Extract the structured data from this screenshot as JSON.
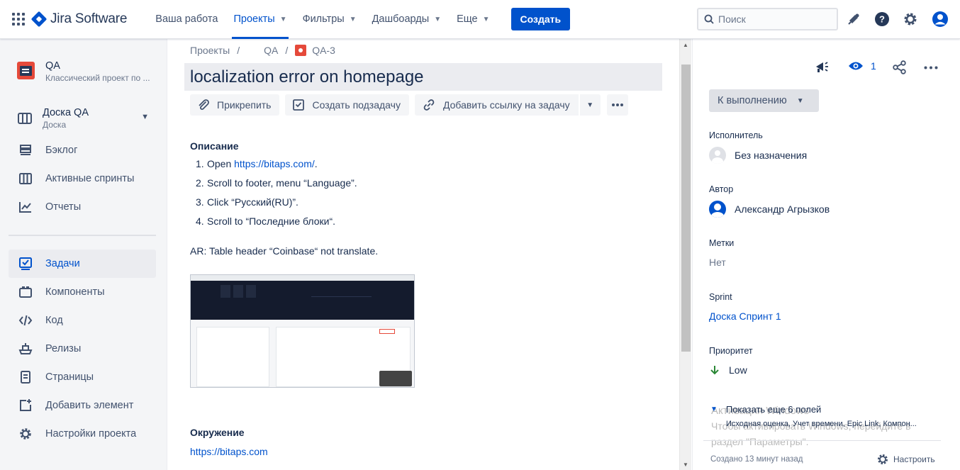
{
  "topnav": {
    "product": "Jira Software",
    "items": [
      {
        "label": "Ваша работа",
        "dropdown": false,
        "active": false
      },
      {
        "label": "Проекты",
        "dropdown": true,
        "active": true
      },
      {
        "label": "Фильтры",
        "dropdown": true,
        "active": false
      },
      {
        "label": "Дашбоарды",
        "dropdown": true,
        "active": false
      },
      {
        "label": "Еще",
        "dropdown": true,
        "active": false
      }
    ],
    "create_label": "Создать",
    "search_placeholder": "Поиск",
    "icons": [
      "apps-icon",
      "jira-logo-icon",
      "search-icon",
      "notifications-icon",
      "help-icon",
      "settings-icon",
      "profile-icon"
    ],
    "accent_color": "#0052cc"
  },
  "sidebar": {
    "project": {
      "name": "QA",
      "type": "Классический проект по ..."
    },
    "board": {
      "name": "Доска QA",
      "sub": "Доска"
    },
    "items_top": [
      {
        "label": "Бэклог",
        "icon": "backlog-icon"
      },
      {
        "label": "Активные спринты",
        "icon": "board-icon"
      },
      {
        "label": "Отчеты",
        "icon": "reports-icon"
      }
    ],
    "items_bottom": [
      {
        "label": "Задачи",
        "icon": "issues-icon",
        "active": true
      },
      {
        "label": "Компоненты",
        "icon": "components-icon"
      },
      {
        "label": "Код",
        "icon": "code-icon"
      },
      {
        "label": "Релизы",
        "icon": "releases-icon"
      },
      {
        "label": "Страницы",
        "icon": "pages-icon"
      },
      {
        "label": "Добавить элемент",
        "icon": "add-item-icon"
      },
      {
        "label": "Настройки проекта",
        "icon": "settings-icon"
      }
    ]
  },
  "issue": {
    "breadcrumb": [
      "Проекты",
      "QA",
      "QA-3"
    ],
    "title": "localization error on homepage",
    "actions": {
      "attach": "Прикрепить",
      "subtask": "Создать подзадачу",
      "link": "Добавить ссылку на задачу"
    },
    "description_label": "Описание",
    "steps": [
      {
        "num": "1.",
        "prefix": "Open ",
        "link": "https://bitaps.com/",
        "suffix": "."
      },
      {
        "num": "2.",
        "text": "Scroll to footer, menu “Language”."
      },
      {
        "num": "3.",
        "text": "Click “Русский(RU)”."
      },
      {
        "num": "4.",
        "text": "Scroll to “Последние блоки“."
      }
    ],
    "ar_text": "AR: Table header “Coinbase“ not translate.",
    "environment_label": "Окружение",
    "environment_link": "https://bitaps.com"
  },
  "details": {
    "watchers_count": "1",
    "status": "К выполнению",
    "fields": [
      {
        "label": "Исполнитель",
        "value": "Без назначения"
      },
      {
        "label": "Автор",
        "value": "Александр Агрызков"
      },
      {
        "label": "Метки",
        "value": "Нет"
      },
      {
        "label": "Sprint",
        "value": "Доска Спринт 1"
      },
      {
        "label": "Приоритет",
        "value": "Low"
      }
    ],
    "show_more": "Показать еще 6 полей",
    "show_more_sub": "Исходная оценка, Учет времени, Epic Link, Компон...",
    "created": "Создано 13 минут назад",
    "configure": "Настроить",
    "watermark": [
      "Активация Windows",
      "Чтобы активировать Windows, перейдите в",
      "раздел \"Параметры\"."
    ]
  }
}
